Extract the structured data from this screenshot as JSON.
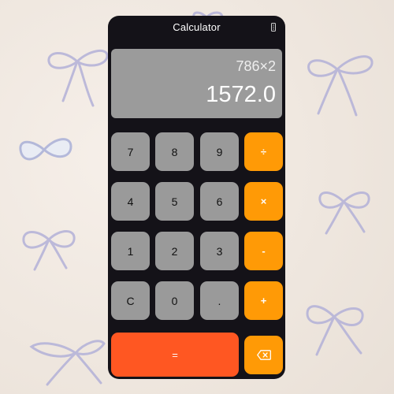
{
  "app": {
    "title": "Calculator"
  },
  "display": {
    "expression": "786×2",
    "result": "1572.0"
  },
  "keys": {
    "row1": [
      "7",
      "8",
      "9",
      "÷"
    ],
    "row2": [
      "4",
      "5",
      "6",
      "×"
    ],
    "row3": [
      "1",
      "2",
      "3",
      "-"
    ],
    "row4": [
      "C",
      "0",
      ".",
      "+"
    ],
    "equals": "=",
    "backspace_icon": "backspace-icon"
  },
  "colors": {
    "device_background": "#141218",
    "display_background": "#9b9b9b",
    "digit_key": "#9a9a9a",
    "operator_key": "#ff9a06",
    "equals_key": "#ff5722",
    "ribbon": "#b9b7da"
  }
}
